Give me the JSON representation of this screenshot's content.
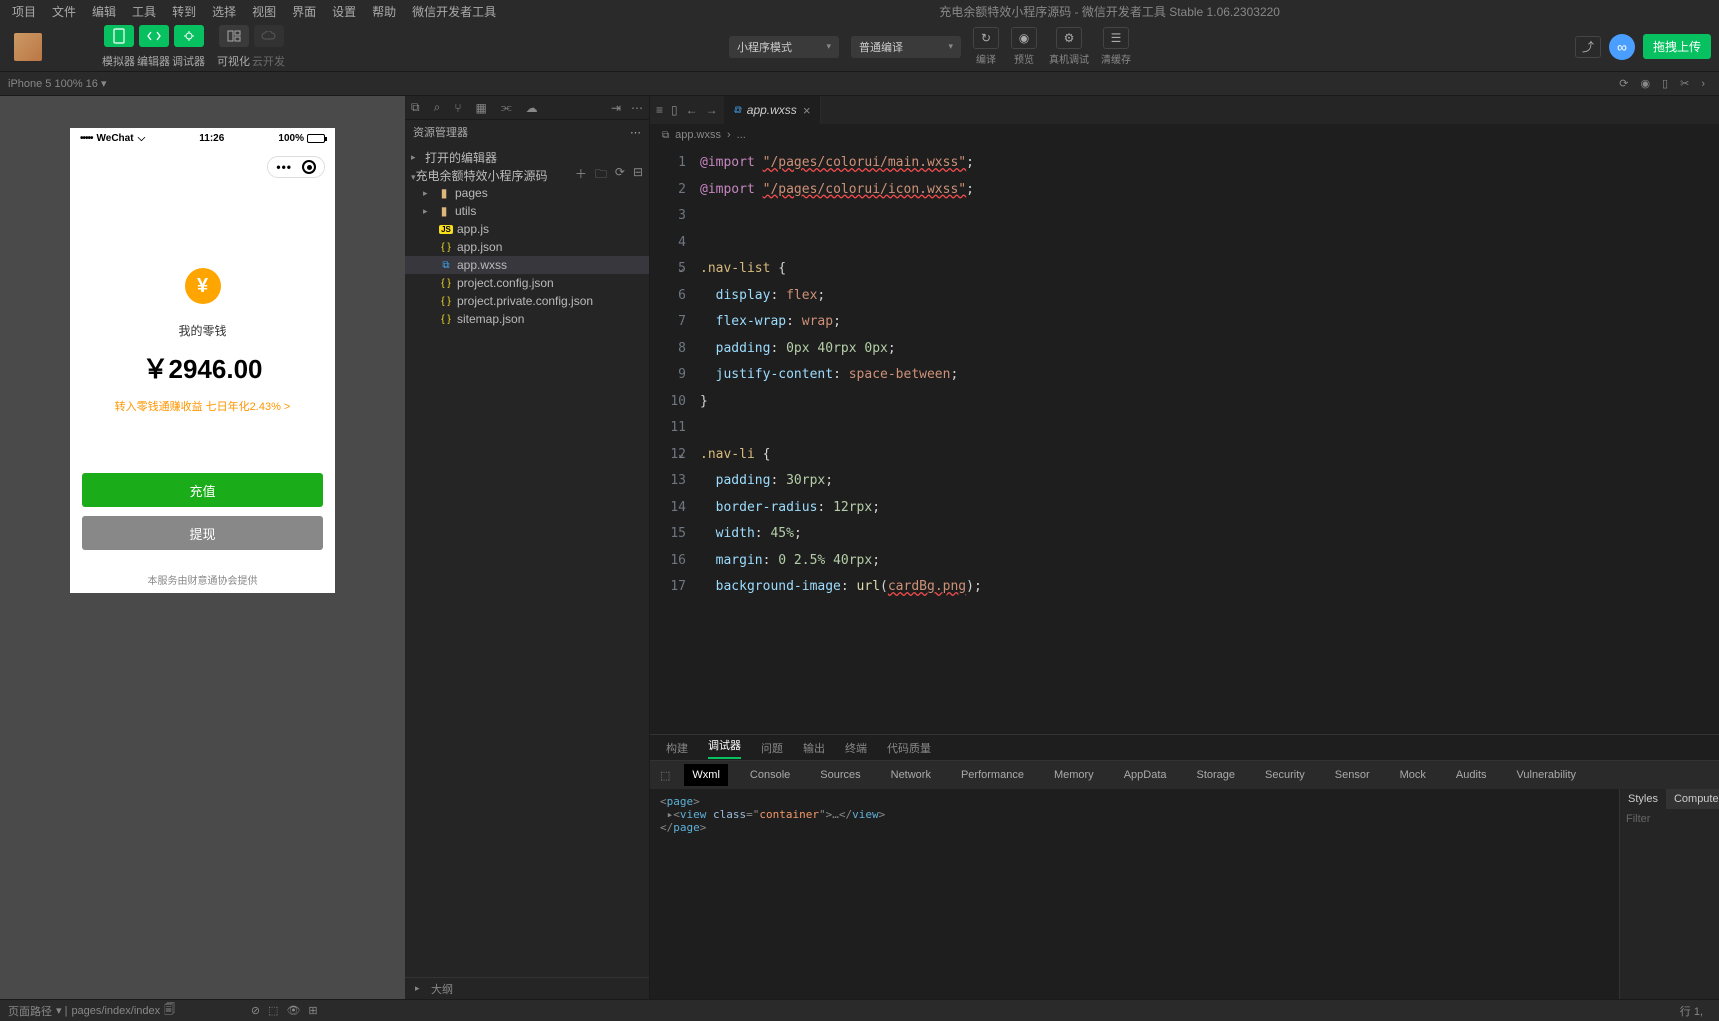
{
  "menubar": {
    "items": [
      "项目",
      "文件",
      "编辑",
      "工具",
      "转到",
      "选择",
      "视图",
      "界面",
      "设置",
      "帮助",
      "微信开发者工具"
    ],
    "title": "充电余额特效小程序源码 - 微信开发者工具 Stable 1.06.2303220"
  },
  "toolbar": {
    "modes": {
      "sim": "模拟器",
      "editor": "编辑器",
      "debugger": "调试器",
      "visual": "可视化",
      "cloud": "云开发"
    },
    "mode_dropdown": "小程序模式",
    "compile_dropdown": "普通编译",
    "actions": {
      "compile": "编译",
      "preview": "预览",
      "realdebug": "真机调试",
      "clearcache": "清缓存"
    },
    "upload": "拖拽上传"
  },
  "devicebar": {
    "device": "iPhone 5 100% 16"
  },
  "simulator": {
    "status": {
      "carrier": "WeChat",
      "time": "11:26",
      "battery": "100%"
    },
    "wallet_label": "我的零钱",
    "amount": "￥2946.00",
    "promo": "转入零钱通赚收益 七日年化2.43% >",
    "btn_primary": "充值",
    "btn_secondary": "提现",
    "footer": "本服务由财意通协会提供"
  },
  "explorer": {
    "title": "资源管理器",
    "open_editors": "打开的编辑器",
    "root": "充电余额特效小程序源码",
    "tree": {
      "pages": "pages",
      "utils": "utils",
      "appjs": "app.js",
      "appjson": "app.json",
      "appwxss": "app.wxss",
      "projcfg": "project.config.json",
      "projpriv": "project.private.config.json",
      "sitemap": "sitemap.json"
    }
  },
  "editor": {
    "tab": "app.wxss",
    "breadcrumb": "app.wxss",
    "lines": [
      "1",
      "2",
      "3",
      "4",
      "5",
      "6",
      "7",
      "8",
      "9",
      "10",
      "11",
      "12",
      "13",
      "14",
      "15",
      "16",
      "17"
    ],
    "code": {
      "l1_import": "@import",
      "l1_str": "\"/pages/colorui/main.wxss\"",
      "l2_import": "@import",
      "l2_str": "\"/pages/colorui/icon.wxss\"",
      "sel_navlist": ".nav-list",
      "brace_o": "{",
      "brace_c": "}",
      "p_display": "display",
      "v_flex": "flex",
      "p_flexwrap": "flex-wrap",
      "v_wrap": "wrap",
      "p_padding": "padding",
      "v_pad1a": "0px",
      "v_pad1b": "40rpx",
      "v_pad1c": "0px",
      "p_justify": "justify-content",
      "v_sb": "space-between",
      "sel_navli": ".nav-li",
      "v_pad2": "30rpx",
      "p_br": "border-radius",
      "v_br": "12rpx",
      "p_width": "width",
      "v_width": "45%",
      "p_margin": "margin",
      "v_m": "0 2.5% 40rpx",
      "p_bgimg": "background-image",
      "fn_url": "url",
      "v_bgimg": "cardBg.png"
    }
  },
  "debugger": {
    "tabs1": [
      "构建",
      "调试器",
      "问题",
      "输出",
      "终端",
      "代码质量"
    ],
    "tabs2": [
      "Wxml",
      "Console",
      "Sources",
      "Network",
      "Performance",
      "Memory",
      "AppData",
      "Storage",
      "Security",
      "Sensor",
      "Mock",
      "Audits",
      "Vulnerability"
    ],
    "styles_tabs": [
      "Styles",
      "Computed"
    ],
    "filter": "Filter",
    "dom": {
      "page": "page",
      "view": "view",
      "cls_attr": "class",
      "cls_val": "container"
    }
  },
  "outline": {
    "label": "大纲"
  },
  "statusbar": {
    "path_label": "页面路径",
    "path": "pages/index/index",
    "ln": "行 1,"
  }
}
